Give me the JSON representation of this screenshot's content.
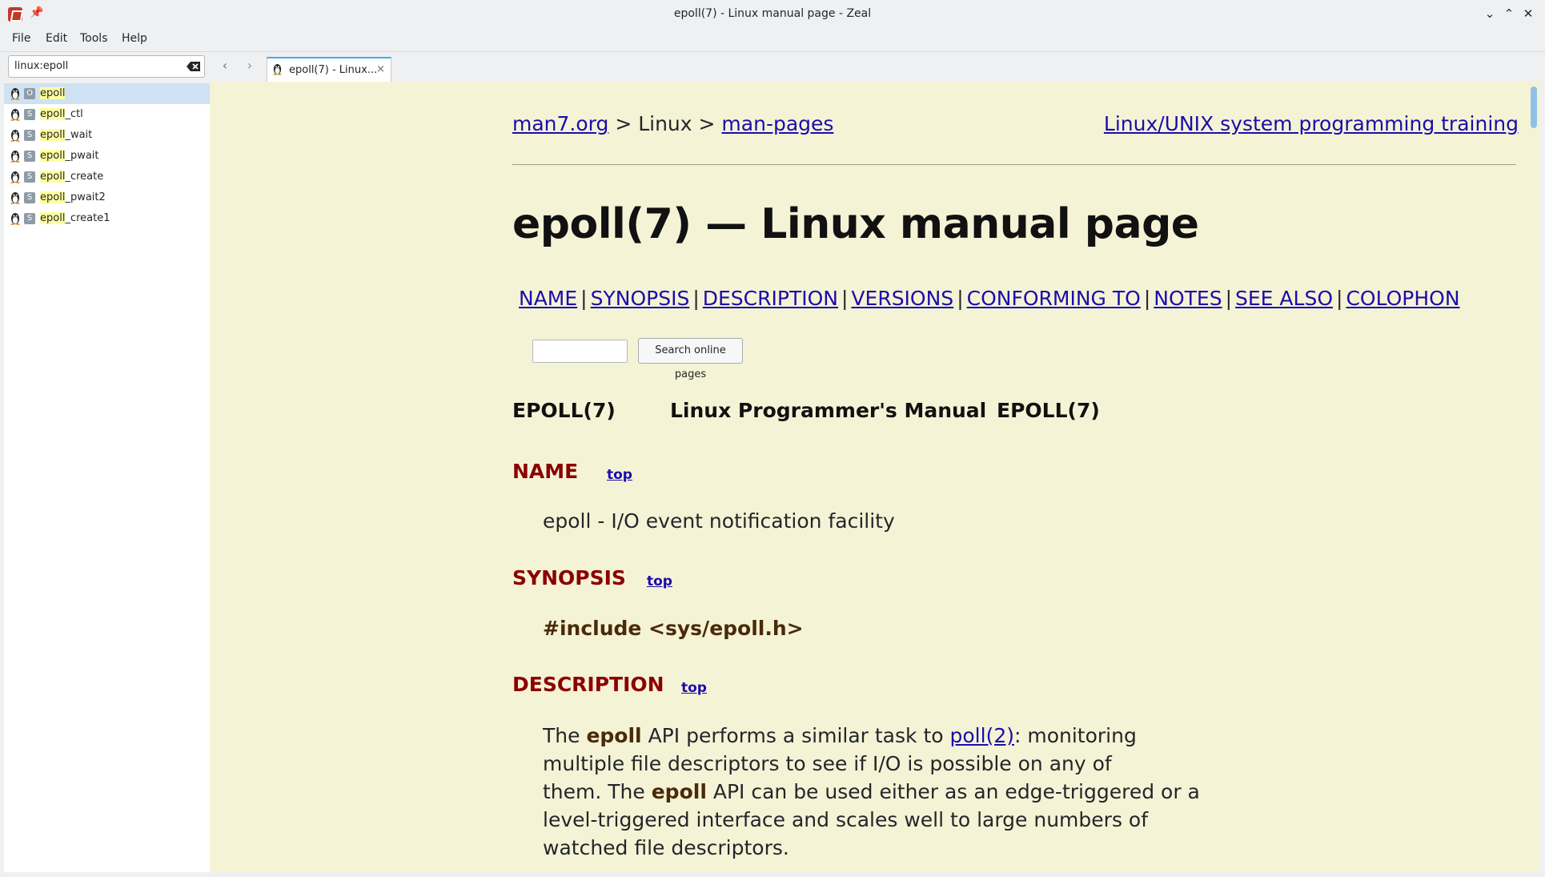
{
  "window": {
    "title": "epoll(7) - Linux manual page - Zeal",
    "controls": {
      "minimize": "⌄",
      "maximize": "⌃",
      "close": "✕"
    }
  },
  "menu": {
    "file": "File",
    "edit": "Edit",
    "tools": "Tools",
    "help": "Help"
  },
  "search": {
    "value": "linux:epoll"
  },
  "results": [
    {
      "prefix": "epoll",
      "rest": "",
      "type": "O"
    },
    {
      "prefix": "epoll",
      "rest": "_ctl",
      "type": "S"
    },
    {
      "prefix": "epoll",
      "rest": "_wait",
      "type": "S"
    },
    {
      "prefix": "epoll",
      "rest": "_pwait",
      "type": "S"
    },
    {
      "prefix": "epoll",
      "rest": "_create",
      "type": "S"
    },
    {
      "prefix": "epoll",
      "rest": "_pwait2",
      "type": "S"
    },
    {
      "prefix": "epoll",
      "rest": "_create1",
      "type": "S"
    }
  ],
  "tab": {
    "label": "epoll(7) - Linux...",
    "close": "×"
  },
  "nav": {
    "back": "‹",
    "forward": "›"
  },
  "page": {
    "crumb_site": "man7.org",
    "crumb_sep1": " > Linux > ",
    "crumb_pages": "man-pages",
    "training": "Linux/UNIX system programming training",
    "title": "epoll(7) — Linux manual page",
    "sections": [
      "NAME",
      "SYNOPSIS",
      "DESCRIPTION",
      "VERSIONS",
      "CONFORMING TO",
      "NOTES",
      "SEE ALSO",
      "COLOPHON"
    ],
    "search_button": "Search online pages",
    "header_left": "EPOLL(7)",
    "header_center": "Linux Programmer's Manual",
    "header_right": "EPOLL(7)",
    "top_link": "top",
    "name_title": "NAME",
    "name_text": "epoll - I/O event notification facility",
    "synopsis_title": "SYNOPSIS",
    "synopsis_include": "#include <sys/epoll.h>",
    "description_title": "DESCRIPTION",
    "desc": {
      "p1": "The ",
      "b1": "epoll",
      "p2": " API performs a similar task to ",
      "link": "poll(2)",
      "p3": ": monitoring",
      "line2": "multiple file descriptors to see if I/O is possible on any of",
      "p4": "them.  The ",
      "b2": "epoll",
      "p5": " API can be used either as an edge-triggered or a",
      "line4": "level-triggered interface and scales well to large numbers of",
      "line5": "watched file descriptors."
    }
  },
  "colors": {
    "content_bg": "#f5f3d6",
    "section_title": "#8b0000",
    "link": "#1a0dab",
    "selection": "#cfe2f3",
    "highlight": "#ffffa0"
  }
}
